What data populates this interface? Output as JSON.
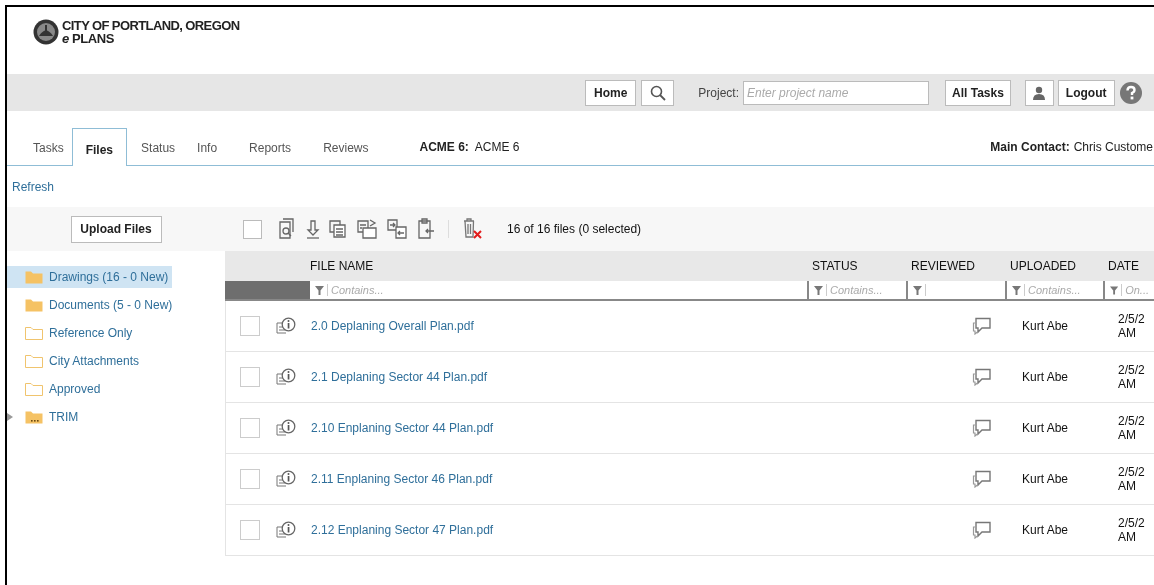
{
  "header": {
    "logo_title": "CITY OF PORTLAND, OREGON",
    "logo_subtitle": "*e* PLANS"
  },
  "nav": {
    "home": "Home",
    "project_label": "Project:",
    "project_placeholder": "Enter project name",
    "all_tasks": "All Tasks",
    "logout": "Logout"
  },
  "tabs": [
    {
      "label": "Tasks",
      "selected": false
    },
    {
      "label": "Files",
      "selected": true
    },
    {
      "label": "Status",
      "selected": false
    },
    {
      "label": "Info",
      "selected": false
    },
    {
      "label": "Reports",
      "selected": false
    },
    {
      "label": "Reviews",
      "selected": false
    }
  ],
  "project": {
    "label": "ACME 6:",
    "name": "ACME 6"
  },
  "main_contact": {
    "label": "Main Contact:",
    "name": "Chris Custome"
  },
  "refresh": "Refresh",
  "upload_button": "Upload Files",
  "folders": [
    {
      "label": "Drawings (16 - 0 New)",
      "kind": "filled",
      "selected": true,
      "expandable": false
    },
    {
      "label": "Documents (5 - 0 New)",
      "kind": "filled",
      "selected": false,
      "expandable": false
    },
    {
      "label": "Reference Only",
      "kind": "outline",
      "selected": false,
      "expandable": false
    },
    {
      "label": "City Attachments",
      "kind": "outline",
      "selected": false,
      "expandable": false
    },
    {
      "label": "Approved",
      "kind": "outline",
      "selected": false,
      "expandable": false
    },
    {
      "label": "TRIM",
      "kind": "archive",
      "selected": false,
      "expandable": true
    }
  ],
  "toolbar": {
    "select_all_checked": false,
    "file_count": "16 of 16 files (0 selected)"
  },
  "table": {
    "columns": [
      "FILE NAME",
      "STATUS",
      "REVIEWED",
      "UPLOADED",
      "DATE"
    ],
    "filters": [
      {
        "kind": "text",
        "placeholder": "Contains..."
      },
      {
        "kind": "text",
        "placeholder": "Contains..."
      },
      {
        "kind": "blank"
      },
      {
        "kind": "text",
        "placeholder": "Contains..."
      },
      {
        "kind": "text",
        "placeholder": "On..."
      }
    ],
    "rows": [
      {
        "checked": false,
        "name": "2.0 Deplaning Overall Plan.pdf",
        "uploaded": "Kurt Abe",
        "date_line_1": "2/5/2",
        "date_line_2": "AM"
      },
      {
        "checked": false,
        "name": "2.1 Deplaning Sector 44 Plan.pdf",
        "uploaded": "Kurt Abe",
        "date_line_1": "2/5/2",
        "date_line_2": "AM"
      },
      {
        "checked": false,
        "name": "2.10 Enplaning Sector 44 Plan.pdf",
        "uploaded": "Kurt Abe",
        "date_line_1": "2/5/2",
        "date_line_2": "AM"
      },
      {
        "checked": false,
        "name": "2.11 Enplaning Sector 46 Plan.pdf",
        "uploaded": "Kurt Abe",
        "date_line_1": "2/5/2",
        "date_line_2": "AM"
      },
      {
        "checked": false,
        "name": "2.12 Enplaning Sector 47 Plan.pdf",
        "uploaded": "Kurt Abe",
        "date_line_1": "2/5/2",
        "date_line_2": "AM"
      }
    ]
  }
}
